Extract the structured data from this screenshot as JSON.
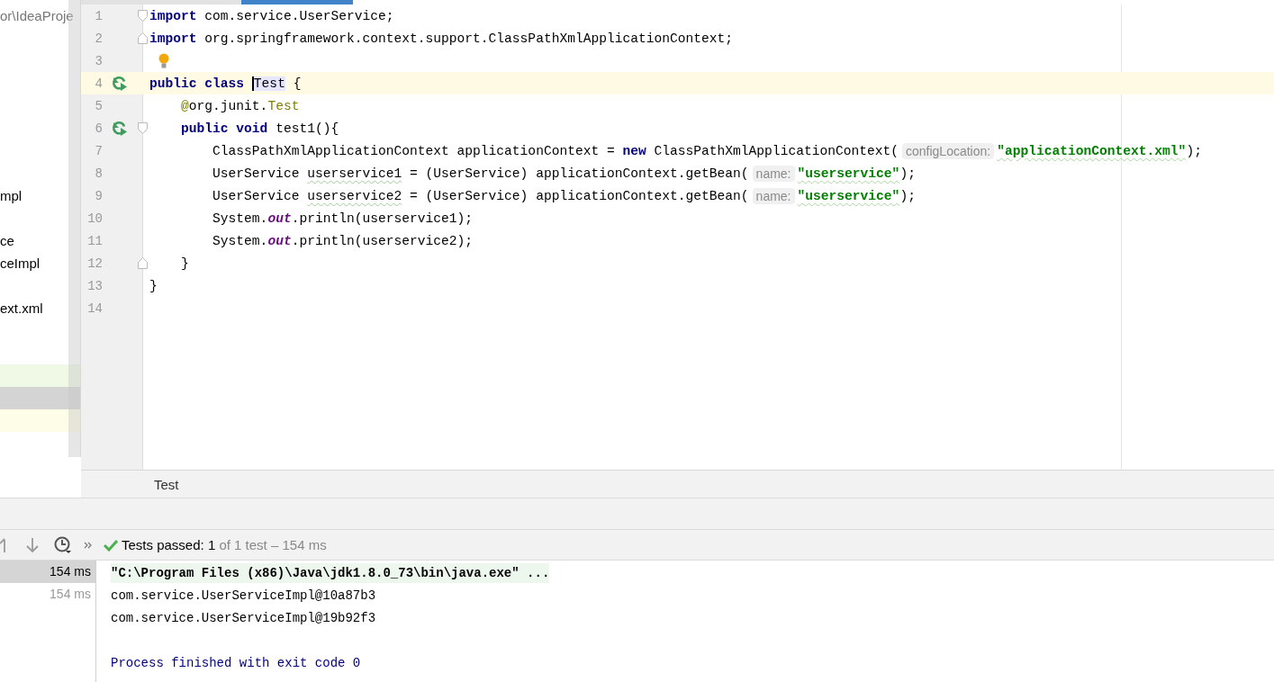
{
  "project_panel": {
    "rows": [
      {
        "kind": "item",
        "label": "or\\IdeaProje"
      },
      {
        "kind": "blank"
      },
      {
        "kind": "blank"
      },
      {
        "kind": "blank"
      },
      {
        "kind": "blank"
      },
      {
        "kind": "blank"
      },
      {
        "kind": "blank"
      },
      {
        "kind": "blank"
      },
      {
        "kind": "item",
        "label": "mpl"
      },
      {
        "kind": "blank"
      },
      {
        "kind": "item",
        "label": "ce"
      },
      {
        "kind": "item",
        "label": "ceImpl"
      },
      {
        "kind": "blank"
      },
      {
        "kind": "item",
        "label": "ext.xml"
      },
      {
        "kind": "blank"
      },
      {
        "kind": "blank"
      },
      {
        "kind": "band",
        "color": "#f0f9e6"
      },
      {
        "kind": "band",
        "color": "#d4d4d4"
      },
      {
        "kind": "band",
        "color": "#fdfde8"
      }
    ]
  },
  "editor": {
    "lines": [
      {
        "number": "1",
        "current": false,
        "run_marker": false,
        "bulb": false,
        "fold_start": true,
        "fold_end": false,
        "tokens": [
          {
            "kind": "keyword",
            "text": "import"
          },
          {
            "kind": "plain",
            "text": " com.service.UserService;"
          }
        ]
      },
      {
        "number": "2",
        "current": false,
        "run_marker": false,
        "bulb": false,
        "fold_start": false,
        "fold_end": true,
        "tokens": [
          {
            "kind": "keyword",
            "text": "import"
          },
          {
            "kind": "plain",
            "text": " org.springframework.context.support.ClassPathXmlApplicationContext;"
          }
        ]
      },
      {
        "number": "3",
        "current": false,
        "run_marker": false,
        "bulb": true,
        "fold_start": false,
        "fold_end": false
      },
      {
        "number": "4",
        "current": true,
        "run_marker": true,
        "bulb": false,
        "fold_start": false,
        "fold_end": false,
        "tokens": [
          {
            "kind": "keyword",
            "text": "public class "
          },
          {
            "kind": "caret",
            "text": "Test"
          },
          {
            "kind": "plain",
            "text": " {"
          }
        ]
      },
      {
        "number": "5",
        "current": false,
        "run_marker": false,
        "bulb": false,
        "fold_start": false,
        "fold_end": false,
        "tokens": [
          {
            "kind": "annotation",
            "text": "    @"
          },
          {
            "kind": "plain",
            "text": "org.junit."
          },
          {
            "kind": "annotation",
            "text": "Test"
          }
        ]
      },
      {
        "number": "6",
        "current": false,
        "run_marker": true,
        "bulb": false,
        "fold_start": true,
        "fold_end": false,
        "tokens": [
          {
            "kind": "keyword",
            "text": "    public void "
          },
          {
            "kind": "plain",
            "text": "test1(){"
          }
        ]
      },
      {
        "number": "7",
        "current": false,
        "run_marker": false,
        "bulb": false,
        "fold_start": false,
        "fold_end": false,
        "tokens": [
          {
            "kind": "plain",
            "text": "        ClassPathXmlApplicationContext applicationContext = "
          },
          {
            "kind": "keyword",
            "text": "new"
          },
          {
            "kind": "plain",
            "text": " ClassPathXmlApplicationContext("
          },
          {
            "kind": "hint",
            "text": "configLocation:"
          },
          {
            "kind": "string",
            "text": "\"applicationContext.xml\""
          },
          {
            "kind": "plain",
            "text": ");"
          }
        ]
      },
      {
        "number": "8",
        "current": false,
        "run_marker": false,
        "bulb": false,
        "fold_start": false,
        "fold_end": false,
        "tokens": [
          {
            "kind": "plain",
            "text": "        UserService "
          },
          {
            "kind": "warning",
            "text": "userservice1"
          },
          {
            "kind": "plain",
            "text": " = (UserService) applicationContext.getBean("
          },
          {
            "kind": "hint",
            "text": "name:"
          },
          {
            "kind": "string",
            "text": "\"userservice\""
          },
          {
            "kind": "plain",
            "text": ");"
          }
        ]
      },
      {
        "number": "9",
        "current": false,
        "run_marker": false,
        "bulb": false,
        "fold_start": false,
        "fold_end": false,
        "tokens": [
          {
            "kind": "plain",
            "text": "        UserService "
          },
          {
            "kind": "warning",
            "text": "userservice2"
          },
          {
            "kind": "plain",
            "text": " = (UserService) applicationContext.getBean("
          },
          {
            "kind": "hint",
            "text": "name:"
          },
          {
            "kind": "string",
            "text": "\"userservice\""
          },
          {
            "kind": "plain",
            "text": ");"
          }
        ]
      },
      {
        "number": "10",
        "current": false,
        "run_marker": false,
        "bulb": false,
        "fold_start": false,
        "fold_end": false,
        "tokens": [
          {
            "kind": "plain",
            "text": "        System."
          },
          {
            "kind": "static",
            "text": "out"
          },
          {
            "kind": "plain",
            "text": ".println(userservice1);"
          }
        ]
      },
      {
        "number": "11",
        "current": false,
        "run_marker": false,
        "bulb": false,
        "fold_start": false,
        "fold_end": false,
        "tokens": [
          {
            "kind": "plain",
            "text": "        System."
          },
          {
            "kind": "static",
            "text": "out"
          },
          {
            "kind": "plain",
            "text": ".println(userservice2);"
          }
        ]
      },
      {
        "number": "12",
        "current": false,
        "run_marker": false,
        "bulb": false,
        "fold_start": false,
        "fold_end": true,
        "tokens": [
          {
            "kind": "plain",
            "text": "    }"
          }
        ]
      },
      {
        "number": "13",
        "current": false,
        "run_marker": false,
        "bulb": false,
        "fold_start": false,
        "fold_end": false,
        "tokens": [
          {
            "kind": "plain",
            "text": "}"
          }
        ]
      },
      {
        "number": "14",
        "current": false,
        "run_marker": false,
        "bulb": false,
        "fold_start": false,
        "fold_end": false
      }
    ],
    "breadcrumb": "Test"
  },
  "run_panel": {
    "status": {
      "label": "Tests passed:",
      "count": "1",
      "detail": "of 1 test – 154 ms"
    },
    "tree": [
      {
        "time": "154 ms",
        "selected": true
      },
      {
        "time": "154 ms",
        "selected": false
      }
    ],
    "console": [
      {
        "kind": "command",
        "text": "\"C:\\Program Files (x86)\\Java\\jdk1.8.0_73\\bin\\java.exe\" ..."
      },
      {
        "kind": "output",
        "text": "com.service.UserServiceImpl@10a87b3"
      },
      {
        "kind": "output",
        "text": "com.service.UserServiceImpl@19b92f3"
      },
      {
        "kind": "blank"
      },
      {
        "kind": "exit",
        "text": "Process finished with exit code 0"
      }
    ]
  }
}
